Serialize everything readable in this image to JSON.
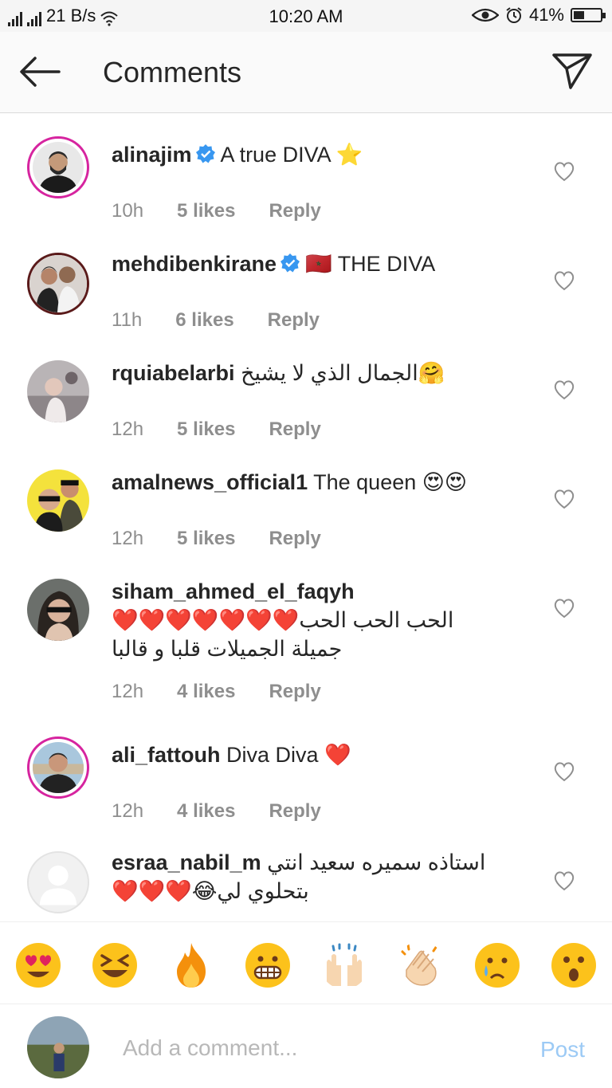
{
  "status_bar": {
    "speed": "21 B/s",
    "time": "10:20 AM",
    "battery_percent": "41%",
    "battery_level": 0.41
  },
  "header": {
    "title": "Comments",
    "back_icon": "arrow-left-icon",
    "share_icon": "paper-plane-icon"
  },
  "comments": [
    {
      "user": "alinajim",
      "verified": true,
      "text": "A true DIVA ⭐",
      "time": "10h",
      "likes": "5 likes",
      "reply": "Reply",
      "story_ring": true
    },
    {
      "user": "mehdibenkirane",
      "verified": true,
      "text": "🇲🇦 THE DIVA",
      "time": "11h",
      "likes": "6 likes",
      "reply": "Reply",
      "story_ring": false
    },
    {
      "user": "rquiabelarbi",
      "verified": false,
      "text": "الجمال الذي لا يشيخ🤗",
      "time": "12h",
      "likes": "5 likes",
      "reply": "Reply",
      "story_ring": false
    },
    {
      "user": "amalnews_official1",
      "verified": false,
      "text": "The queen 😍😍",
      "time": "12h",
      "likes": "5 likes",
      "reply": "Reply",
      "story_ring": false
    },
    {
      "user": "siham_ahmed_el_faqyh",
      "verified": false,
      "text_line1": "الحب الحب الحب❤️❤️❤️❤️❤️❤️❤️",
      "text_line2": "جميلة الجميلات قلبا و قالبا",
      "time": "12h",
      "likes": "4 likes",
      "reply": "Reply",
      "story_ring": false
    },
    {
      "user": "ali_fattouh",
      "verified": false,
      "text": "Diva Diva ❤️",
      "time": "12h",
      "likes": "4 likes",
      "reply": "Reply",
      "story_ring": true
    },
    {
      "user": "esraa_nabil_m",
      "verified": false,
      "text_line1": "استاذه سميره سعيد انتي",
      "text_line2": "بتحلوي لي😂❤️❤️❤️",
      "story_ring": false
    }
  ],
  "quick_emojis": [
    "😍",
    "😆",
    "🔥",
    "😁",
    "🙌",
    "👏",
    "😢",
    "😮"
  ],
  "composer": {
    "placeholder": "Add a comment...",
    "post_label": "Post"
  }
}
